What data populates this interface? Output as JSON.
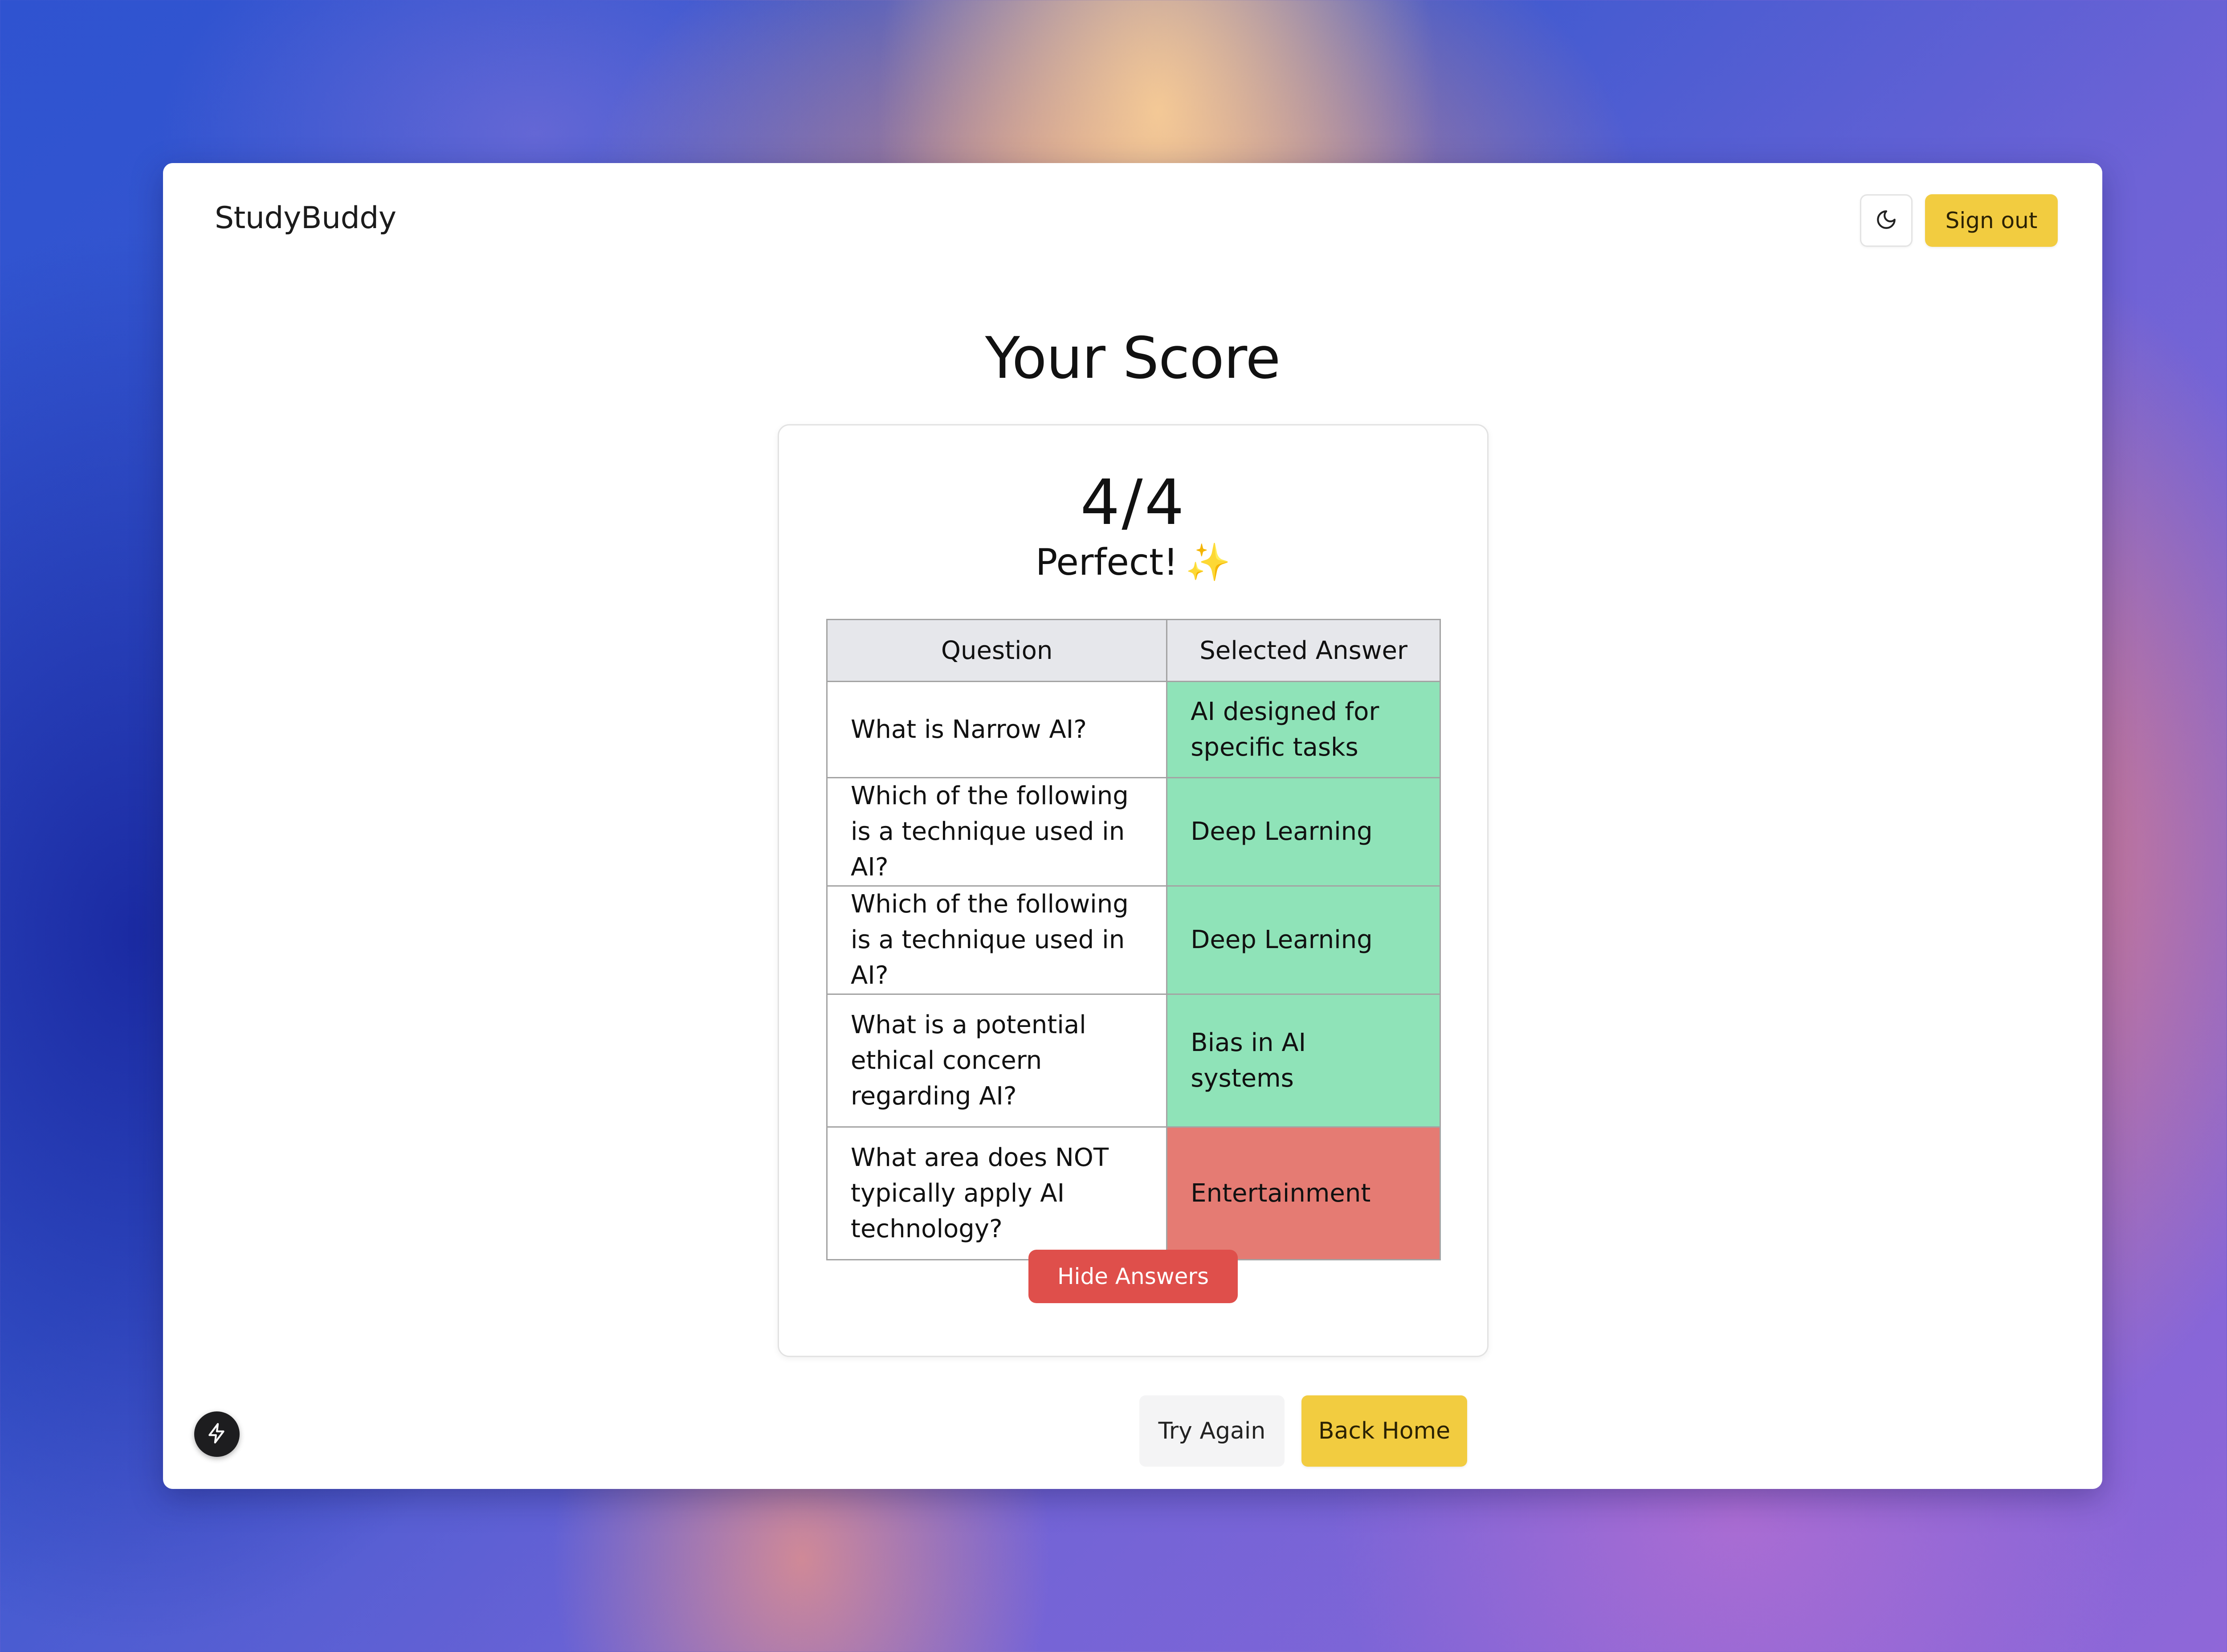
{
  "header": {
    "brand": "StudyBuddy",
    "theme_icon": "moon-icon",
    "signout_label": "Sign out"
  },
  "page": {
    "title": "Your Score"
  },
  "result": {
    "score": "4/4",
    "verdict": "Perfect!",
    "verdict_emoji": "✨",
    "table": {
      "headers": [
        "Question",
        "Selected Answer"
      ],
      "rows": [
        {
          "question": "What is Narrow AI?",
          "answer": "AI designed for specific tasks",
          "status": "correct"
        },
        {
          "question": "Which of the following is a technique used in AI?",
          "answer": "Deep Learning",
          "status": "correct"
        },
        {
          "question": "Which of the following is a technique used in AI?",
          "answer": "Deep Learning",
          "status": "correct"
        },
        {
          "question": "What is a potential ethical concern regarding AI?",
          "answer": "Bias in AI systems",
          "status": "correct"
        },
        {
          "question": "What area does NOT typically apply AI technology?",
          "answer": "Entertainment",
          "status": "incorrect"
        }
      ]
    },
    "hide_answers_label": "Hide Answers"
  },
  "actions": {
    "try_again_label": "Try Again",
    "back_home_label": "Back Home"
  },
  "floating": {
    "icon": "bolt-icon"
  },
  "colors": {
    "accent": "#f2cc40",
    "correct": "#8fe3b8",
    "incorrect": "#e57b73",
    "danger_button": "#df4f4b"
  }
}
